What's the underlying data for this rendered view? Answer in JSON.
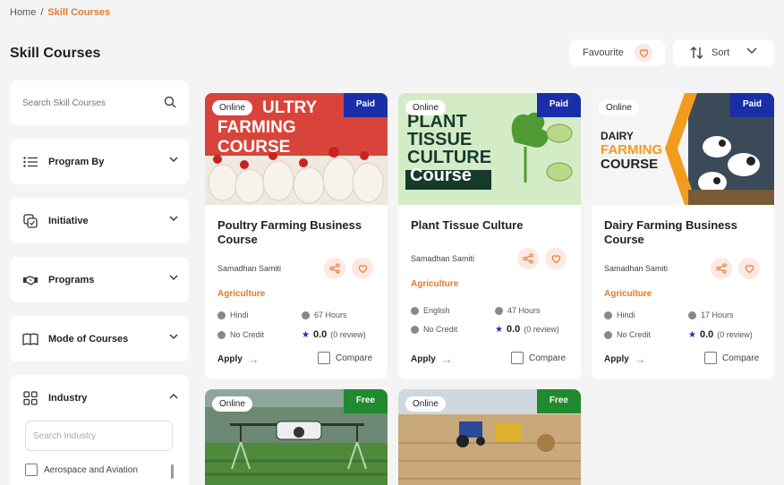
{
  "breadcrumb": {
    "home": "Home",
    "separator": "/",
    "current": "Skill Courses"
  },
  "page_title": "Skill Courses",
  "toolbar": {
    "favourite_label": "Favourite",
    "sort_label": "Sort"
  },
  "sidebar": {
    "search_placeholder": "Search Skill Courses",
    "filters": [
      {
        "label": "Program By",
        "icon": "list-icon"
      },
      {
        "label": "Initiative",
        "icon": "initiative-icon"
      },
      {
        "label": "Programs",
        "icon": "handshake-icon"
      },
      {
        "label": "Mode of Courses",
        "icon": "book-icon"
      },
      {
        "label": "Industry",
        "icon": "grid-icon"
      }
    ],
    "industry": {
      "search_placeholder": "Search Industry",
      "options": [
        "Aerospace and Aviation"
      ]
    }
  },
  "colors": {
    "accent": "#e07b2c",
    "paid": "#1a2ea8",
    "free": "#1f8a2e"
  },
  "cards": [
    {
      "mode": "Online",
      "price": "Paid",
      "title": "Poultry Farming Business Course",
      "institute": "Samadhan Samiti",
      "category": "Agriculture",
      "language": "Hindi",
      "duration": "67 Hours",
      "credit": "No Credit",
      "rating": "0.0",
      "reviews": "(0 review)",
      "apply": "Apply",
      "compare": "Compare",
      "poster": {
        "line1": "ULTRY",
        "line2": "FARMING",
        "line3": "COURSE"
      }
    },
    {
      "mode": "Online",
      "price": "Paid",
      "title": "Plant Tissue Culture",
      "institute": "Samadhan Samiti",
      "category": "Agriculture",
      "language": "English",
      "duration": "47 Hours",
      "credit": "No Credit",
      "rating": "0.0",
      "reviews": "(0 review)",
      "apply": "Apply",
      "compare": "Compare",
      "poster": {
        "line1": "PLANT",
        "line2": "TISSUE",
        "line3": "CULTURE",
        "line4": "Course"
      }
    },
    {
      "mode": "Online",
      "price": "Paid",
      "title": "Dairy Farming Business Course",
      "institute": "Samadhan Samiti",
      "category": "Agriculture",
      "language": "Hindi",
      "duration": "17 Hours",
      "credit": "No Credit",
      "rating": "0.0",
      "reviews": "(0 review)",
      "apply": "Apply",
      "compare": "Compare",
      "poster": {
        "line1": "DAIRY",
        "line2": "FARMING",
        "line3": "COURSE"
      }
    },
    {
      "mode": "Online",
      "price": "Free"
    },
    {
      "mode": "Online",
      "price": "Free"
    }
  ]
}
